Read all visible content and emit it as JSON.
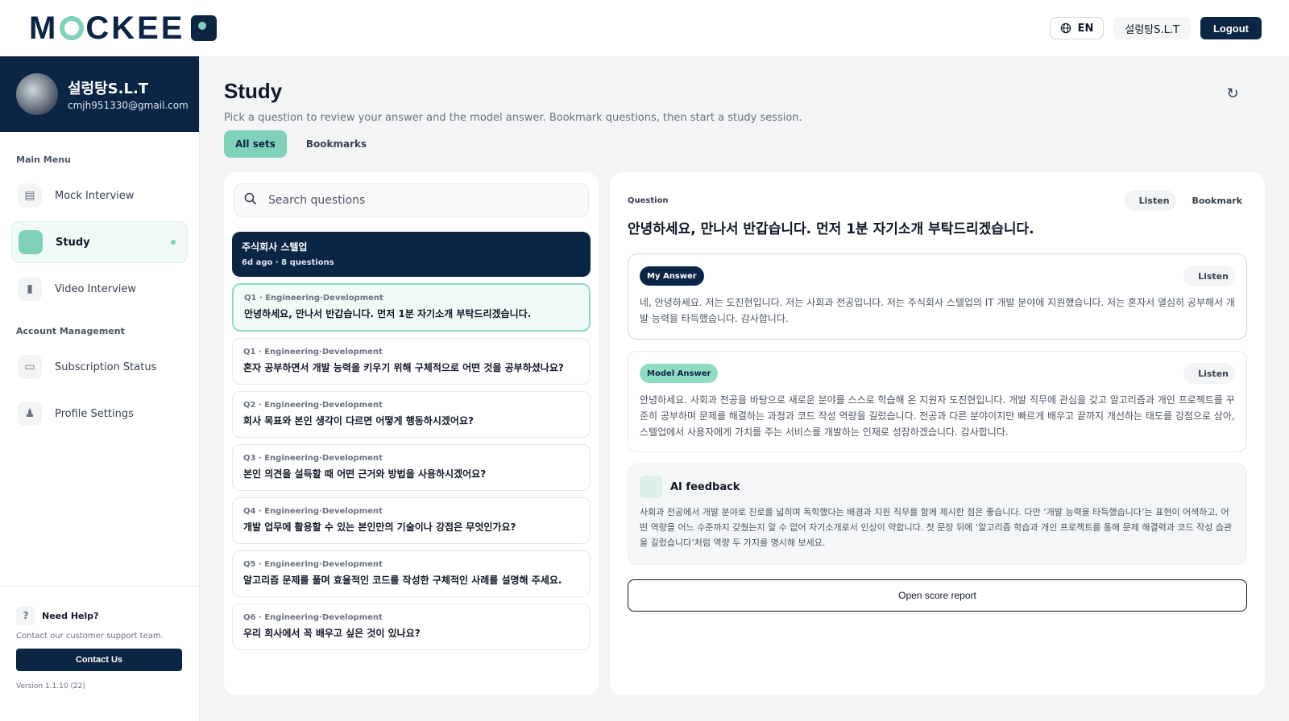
{
  "header": {
    "logo": "MOCKEE",
    "logo_part1": "M",
    "logo_part2": "CKEE",
    "language": "EN",
    "user": "설렁탕S.L.T",
    "logout_label": "Logout"
  },
  "sidebar": {
    "profile": {
      "name": "설렁탕S.L.T",
      "email": "cmjh951330@gmail.com"
    },
    "main_menu_title": "Main Menu",
    "main_items": [
      {
        "label": "Mock Interview",
        "icon": "document-icon"
      },
      {
        "label": "Study",
        "icon": "study-icon",
        "active": true
      },
      {
        "label": "Video Interview",
        "icon": "video-camera-icon"
      }
    ],
    "account_title": "Account Management",
    "account_items": [
      {
        "label": "Subscription Status",
        "icon": "monitor-icon"
      },
      {
        "label": "Profile Settings",
        "icon": "person-icon"
      }
    ],
    "help": {
      "title": "Need Help?",
      "description": "Contact our customer support team.",
      "contact_label": "Contact Us",
      "version": "Version 1.1.10 (22)"
    }
  },
  "page": {
    "title": "Study",
    "subtitle": "Pick a question to review your answer and the model answer. Bookmark questions, then start a study session.",
    "tabs": [
      {
        "label": "All sets",
        "active": true
      },
      {
        "label": "Bookmarks",
        "active": false
      }
    ]
  },
  "search": {
    "placeholder": "Search questions"
  },
  "question_set": {
    "title": "주식회사 스텔업",
    "meta": "6d ago · 8 questions"
  },
  "questions": [
    {
      "meta": "Q1 · Engineering·Development",
      "text": "안녕하세요, 만나서 반갑습니다. 먼저 1분 자기소개 부탁드리겠습니다.",
      "selected": true
    },
    {
      "meta": "Q1 · Engineering·Development",
      "text": "혼자 공부하면서 개발 능력을 키우기 위해 구체적으로 어떤 것을 공부하셨나요?"
    },
    {
      "meta": "Q2 · Engineering·Development",
      "text": "회사 목표와 본인 생각이 다르면 어떻게 행동하시겠어요?"
    },
    {
      "meta": "Q3 · Engineering·Development",
      "text": "본인 의견을 설득할 때 어떤 근거와 방법을 사용하시겠어요?"
    },
    {
      "meta": "Q4 · Engineering·Development",
      "text": "개발 업무에 활용할 수 있는 본인만의 기술이나 강점은 무엇인가요?"
    },
    {
      "meta": "Q5 · Engineering·Development",
      "text": "알고리즘 문제를 풀며 효율적인 코드를 작성한 구체적인 사례를 설명해 주세요."
    },
    {
      "meta": "Q6 · Engineering·Development",
      "text": "우리 회사에서 꼭 배우고 싶은 것이 있나요?"
    }
  ],
  "detail": {
    "question_label": "Question",
    "listen_label": "Listen",
    "bookmark_label": "Bookmark",
    "question": "안녕하세요, 만나서 반갑습니다. 먼저 1분 자기소개 부탁드리겠습니다.",
    "my_answer_label": "My Answer",
    "my_answer": "네, 안녕하세요. 저는 도진현입니다. 저는 사회과 전공입니다. 저는 주식회사 스텔업의 IT 개발 분야에 지원했습니다. 저는 혼자서 열심히 공부해서 개발 능력을 타득했습니다. 감사합니다.",
    "model_answer_label": "Model Answer",
    "model_answer": "안녕하세요. 사회과 전공을 바탕으로 새로운 분야를 스스로 학습해 온 지원자 도진현입니다. 개발 직무에 관심을 갖고 알고리즘과 개인 프로젝트를 꾸준히 공부하며 문제를 해결하는 과정과 코드 작성 역량을 길렀습니다. 전공과 다른 분야이지만 빠르게 배우고 끝까지 개선하는 태도를 강점으로 삼아, 스텔업에서 사용자에게 가치를 주는 서비스를 개발하는 인재로 성장하겠습니다. 감사합니다.",
    "feedback_title": "AI feedback",
    "feedback": "사회과 전공에서 개발 분야로 진로를 넓히며 독학했다는 배경과 지원 직무를 함께 제시한 점은 좋습니다. 다만 ‘개발 능력을 타득했습니다’는 표현이 어색하고, 어떤 역량을 어느 수준까지 갖췄는지 알 수 없어 자기소개로서 인상이 약합니다. 첫 문장 뒤에 ‘알고리즘 학습과 개인 프로젝트를 통해 문제 해결력과 코드 작성 습관을 길렀습니다’처럼 역량 두 가지를 명시해 보세요.",
    "report_label": "Open score report"
  },
  "colors": {
    "navy": "#0b2545",
    "mint": "#7fd1b9"
  }
}
